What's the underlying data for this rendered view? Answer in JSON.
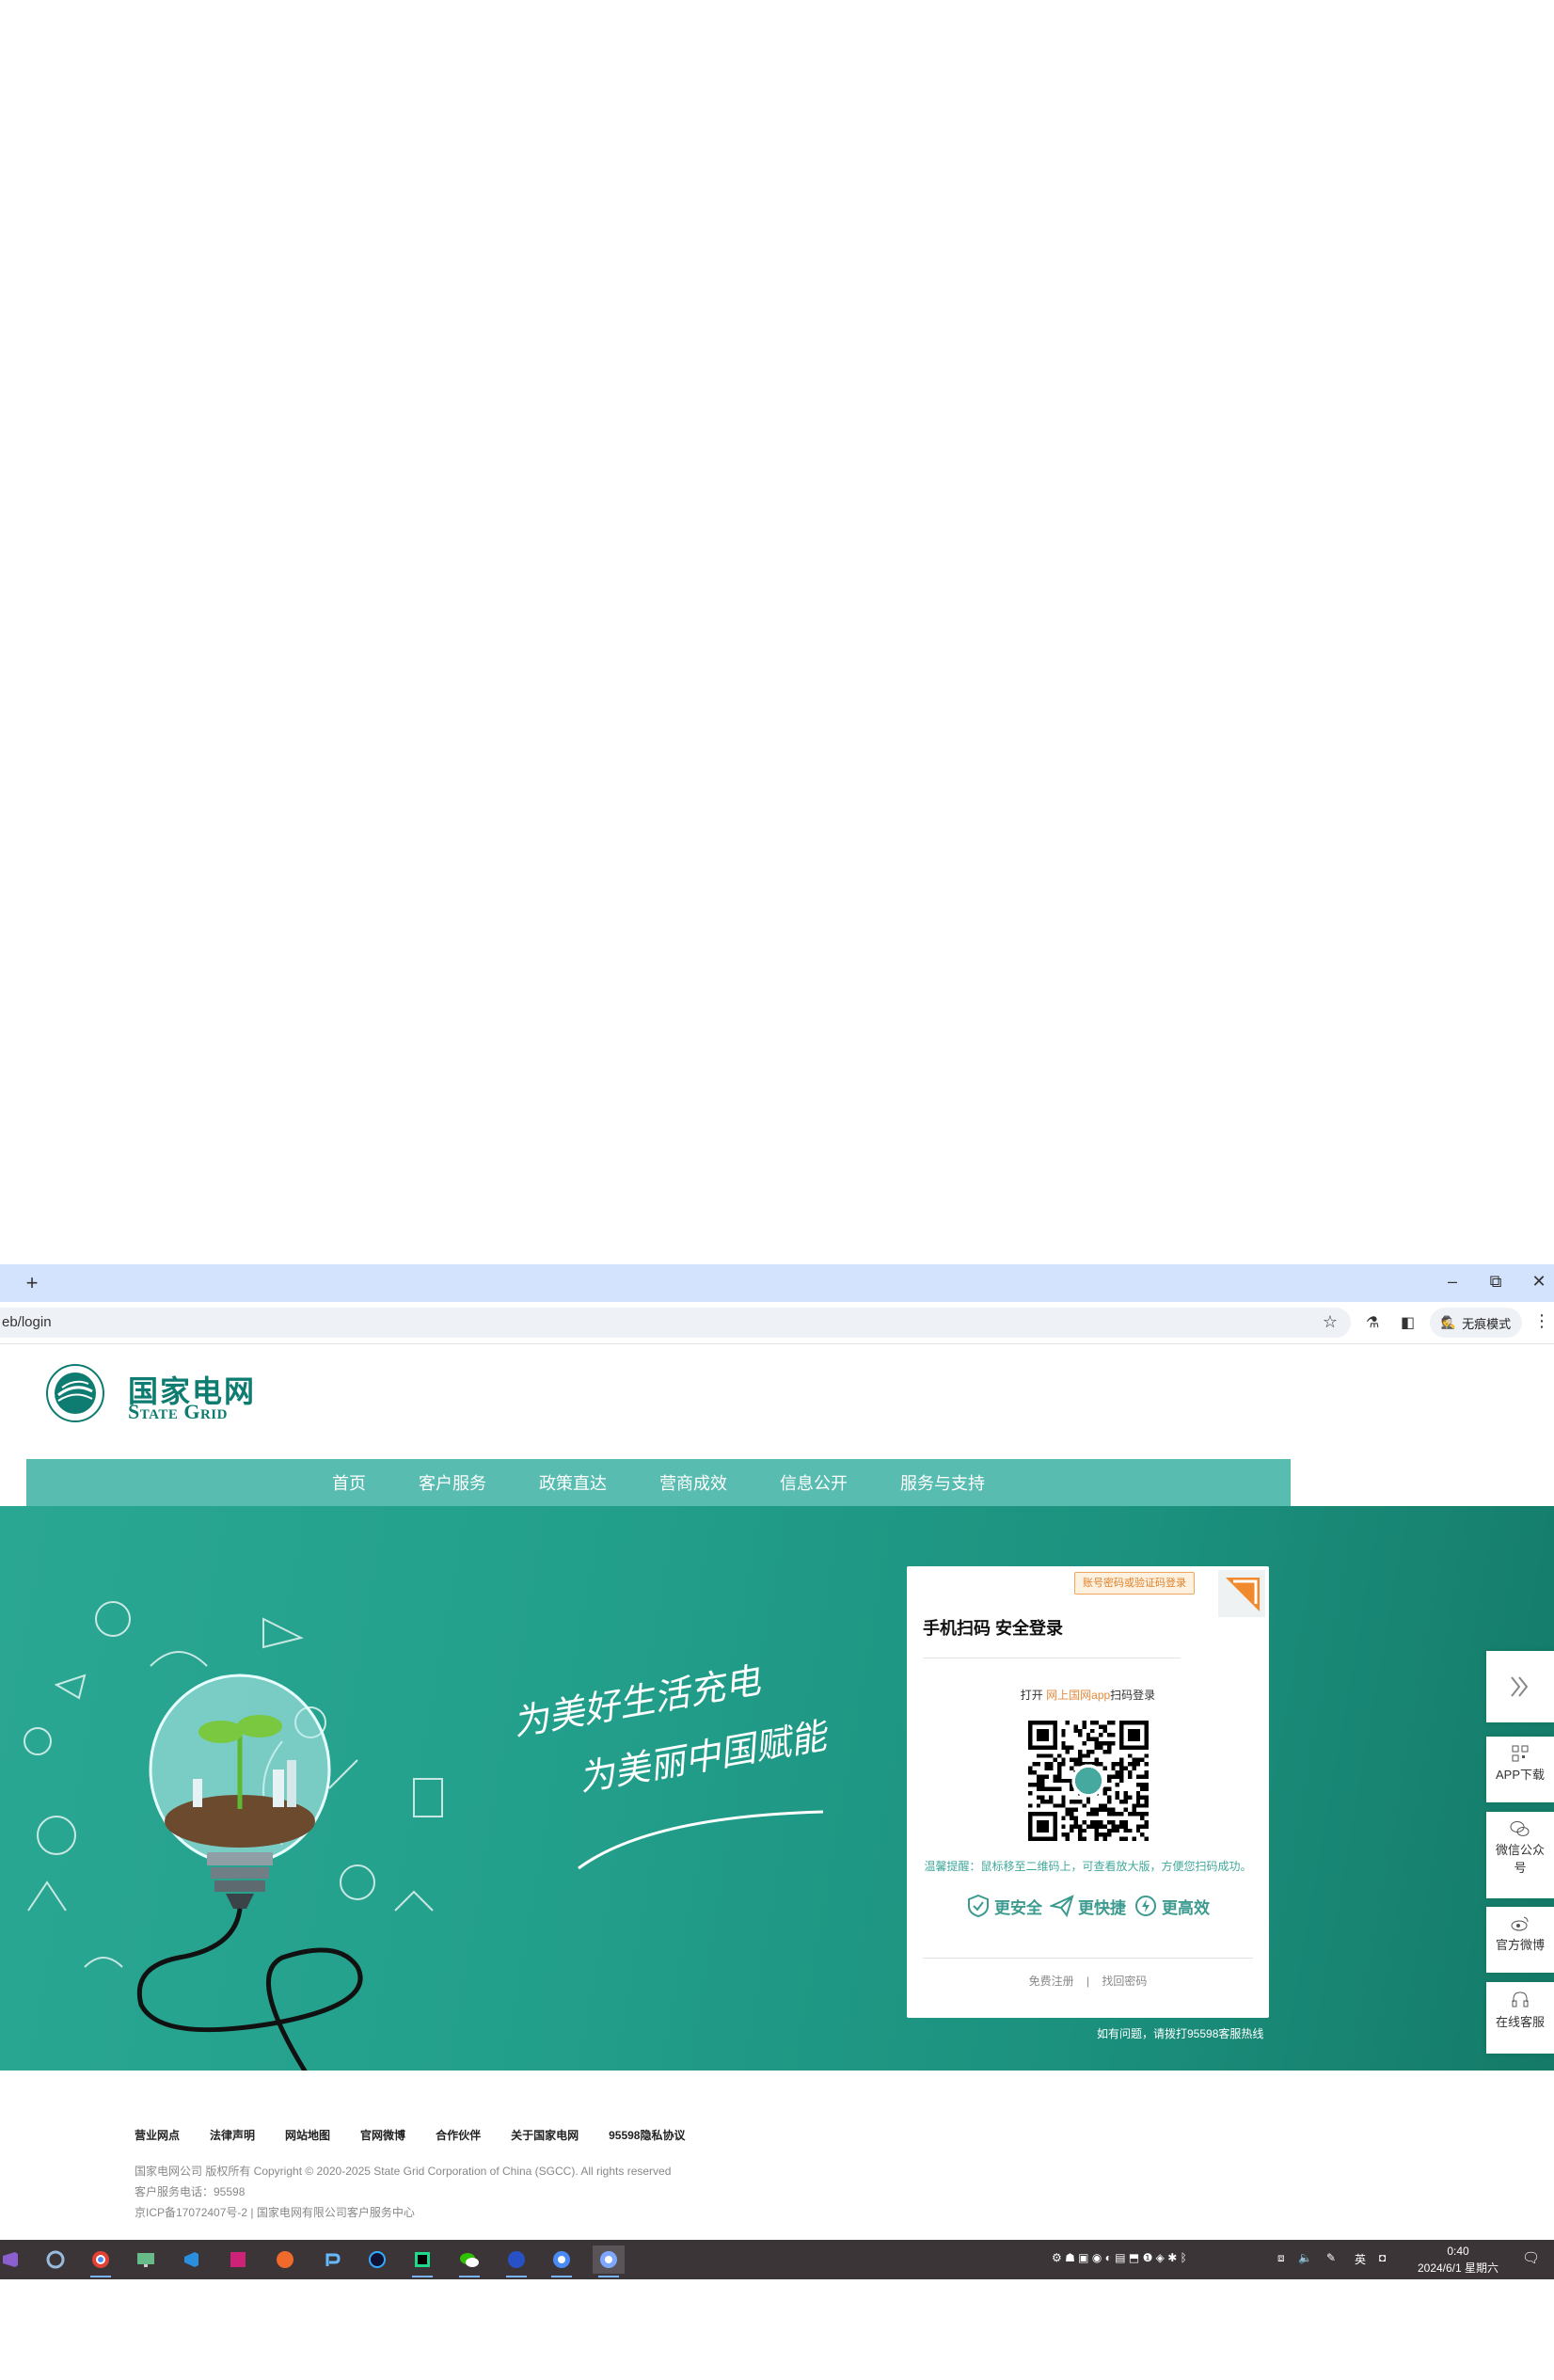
{
  "browser": {
    "url": "eb/login",
    "new_tab": "+",
    "incognito_label": "无痕模式",
    "controls": {
      "minimize": "–",
      "restore": "⧉",
      "close": "✕"
    }
  },
  "site": {
    "logo_cn": "国家电网",
    "logo_en": "State Grid",
    "nav": [
      "首页",
      "客户服务",
      "政策直达",
      "营商成效",
      "信息公开",
      "服务与支持"
    ]
  },
  "hero": {
    "slogan_line1": "为美好生活充电",
    "slogan_line2": "为美丽中国赋能",
    "hotline": "如有问题，请拨打95598客服热线"
  },
  "login": {
    "switch_tip": "账号密码或验证码登录",
    "title": "手机扫码 安全登录",
    "prompt_before": "打开 ",
    "prompt_link": "网上国网app",
    "prompt_after": "扫码登录",
    "hint": "温馨提醒：鼠标移至二维码上，可查看放大版，方便您扫码成功。",
    "features": [
      "更安全",
      "更快捷",
      "更高效"
    ],
    "register": "免费注册",
    "separator": "|",
    "forgot": "找回密码"
  },
  "sidebar": {
    "items": [
      "APP下载",
      "微信公众号",
      "官方微博",
      "在线客服"
    ]
  },
  "footer": {
    "links": [
      "营业网点",
      "法律声明",
      "网站地图",
      "官网微博",
      "合作伙伴",
      "关于国家电网",
      "95598隐私协议"
    ],
    "copyright": "国家电网公司 版权所有 Copyright © 2020-2025 State Grid Corporation of China (SGCC). All rights reserved",
    "phone": "客户服务电话：95598",
    "icp": "京ICP备17072407号-2 | 国家电网有限公司客户服务中心"
  },
  "taskbar": {
    "time": "0:40",
    "date": "2024/6/1 星期六",
    "ime": "英"
  },
  "colors": {
    "brand": "#0e7c70",
    "nav_bg": "#59bcb0",
    "hero_bg": "#23a08c",
    "accent_orange": "#e5893b"
  }
}
